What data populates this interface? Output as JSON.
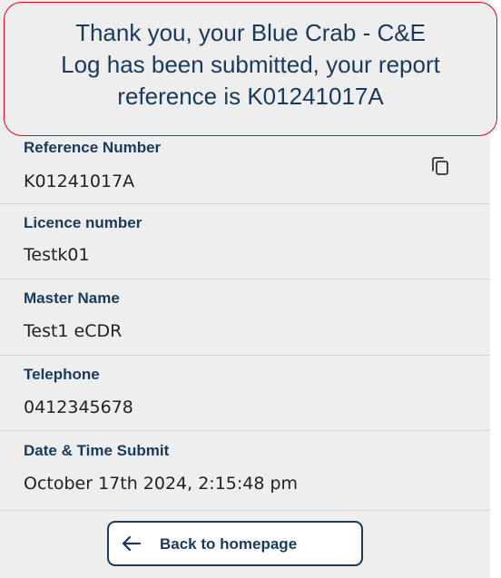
{
  "banner": {
    "lines": [
      "Thank you, your Blue Crab - C&E",
      "Log has been submitted, your report",
      "reference is K01241017A"
    ]
  },
  "fields": [
    {
      "label": "Reference Number",
      "value": "K01241017A"
    },
    {
      "label": "Licence number",
      "value": "Testk01"
    },
    {
      "label": "Master Name",
      "value": "Test1 eCDR"
    },
    {
      "label": "Telephone",
      "value": "0412345678"
    },
    {
      "label": "Date & Time Submit",
      "value": "October 17th 2024, 2:15:48 pm"
    }
  ],
  "actions": {
    "back_label": "Back to homepage"
  },
  "icons": {
    "copy": "copy-icon",
    "back": "arrow-left-icon"
  },
  "colors": {
    "navy": "#1a3a5c",
    "banner_border": "#e3001b",
    "background": "#eeeeee"
  }
}
